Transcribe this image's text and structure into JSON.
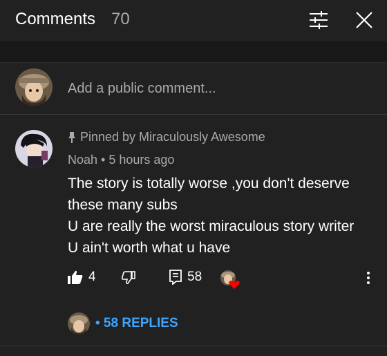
{
  "header": {
    "title": "Comments",
    "count": "70",
    "icons": [
      "filter-icon",
      "close-icon"
    ]
  },
  "add_comment": {
    "placeholder": "Add a public comment..."
  },
  "comment": {
    "pinned_label": "Pinned by Miraculously Awesome",
    "author": "Noah",
    "separator": "•",
    "time": "5 hours ago",
    "body_lines": [
      "The story is totally worse ,you don't deserve",
      "these many subs",
      "U are really the worst miraculous story writer",
      "U ain't worth what u have"
    ],
    "likes": "4",
    "reply_count": "58",
    "replies_link": "• 58 REPLIES"
  },
  "colors": {
    "background": "#212121",
    "accent_blue": "#3ea6ff",
    "secondary_text": "#aaaaaa",
    "heart": "#ff0000"
  }
}
